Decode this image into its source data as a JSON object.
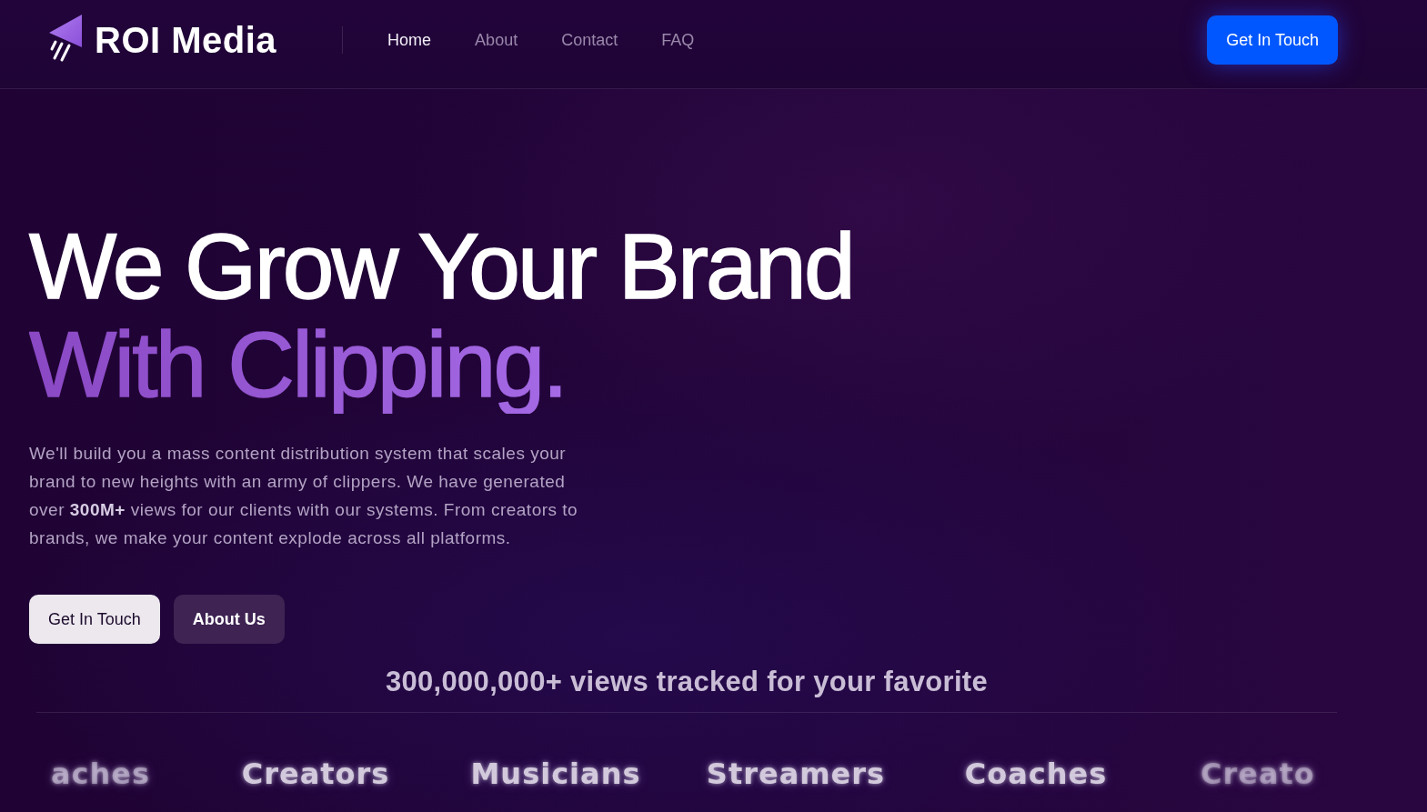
{
  "header": {
    "logo_text": "ROI Media",
    "nav": [
      {
        "label": "Home",
        "selected": true
      },
      {
        "label": "About",
        "selected": false
      },
      {
        "label": "Contact",
        "selected": false
      },
      {
        "label": "FAQ",
        "selected": false
      }
    ],
    "cta": "Get In Touch"
  },
  "hero": {
    "title_line_1": "We Grow Your Brand",
    "title_line_2": "With Clipping.",
    "description": "We'll build you a mass content distribution system that scales your brand to new heights with an army of clippers. We have generated over **300M+** views for our clients with our systems. From creators to brands, we make your content explode across all platforms.",
    "buttons": [
      {
        "label": "Get In Touch",
        "kind": "primary"
      },
      {
        "label": "About Us",
        "kind": "secondary"
      }
    ]
  },
  "stats": {
    "headline": "300,000,000+ views tracked for your favorite",
    "audiences": [
      "aches",
      "Creators",
      "Musicians",
      "Streamers",
      "Coaches",
      "Creato"
    ]
  }
}
